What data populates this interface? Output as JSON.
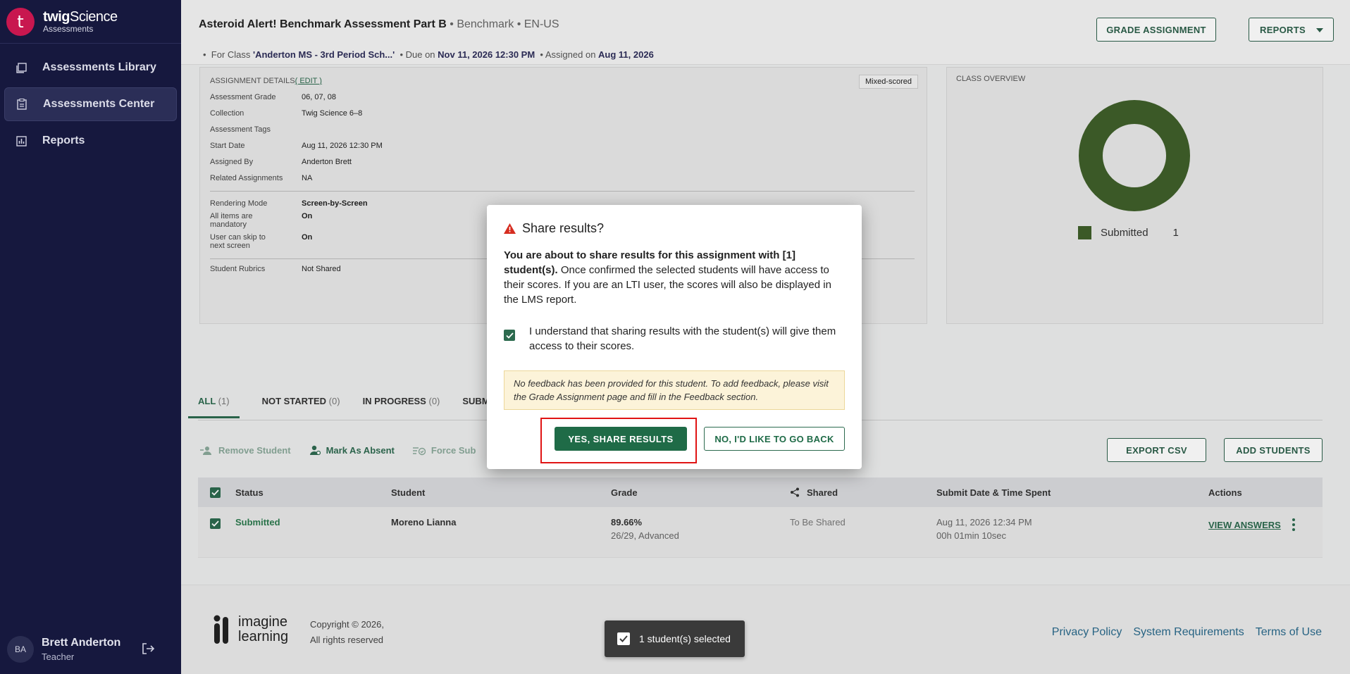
{
  "brand": {
    "name_prefix": "twig",
    "name_suffix": "Science",
    "subtitle": "Assessments",
    "logo_letter": "t"
  },
  "sidebar": {
    "items": [
      {
        "label": "Assessments Library",
        "icon": "library-icon"
      },
      {
        "label": "Assessments Center",
        "icon": "clipboard-icon",
        "active": true
      },
      {
        "label": "Reports",
        "icon": "bar-chart-icon"
      }
    ]
  },
  "user": {
    "initials": "BA",
    "name": "Brett Anderton",
    "role": "Teacher"
  },
  "header": {
    "title": "Asteroid Alert! Benchmark Assessment Part B",
    "type": "• Benchmark",
    "locale": "• EN-US",
    "class_prefix": "For Class ",
    "class_name": "'Anderton MS - 3rd Period Sch...'",
    "due_prefix": "•  Due on ",
    "due_date": "Nov 11, 2026 12:30 PM",
    "assigned_prefix": "•  Assigned on ",
    "assigned_date": "Aug 11, 2026",
    "grade_button": "GRADE ASSIGNMENT",
    "reports_button": "REPORTS"
  },
  "details": {
    "label": "ASSIGNMENT DETAILS",
    "edit_link": "( EDIT )",
    "scoring_badge": "Mixed-scored",
    "rows": [
      {
        "k": "Assessment Grade",
        "v": "06, 07, 08"
      },
      {
        "k": "Collection",
        "v": "Twig Science 6–8"
      },
      {
        "k": "Assessment Tags",
        "v": ""
      },
      {
        "k": "Start Date",
        "v": "Aug 11, 2026 12:30 PM"
      },
      {
        "k": "Assigned By",
        "v": "Anderton Brett"
      },
      {
        "k": "Related Assignments",
        "v": "NA"
      }
    ],
    "rows2": [
      {
        "k": "Rendering Mode",
        "v": "Screen-by-Screen"
      },
      {
        "k": "All items are mandatory",
        "v": "On"
      },
      {
        "k": "User can skip to next screen",
        "v": "On"
      }
    ],
    "rows3": [
      {
        "k": "Student Rubrics",
        "v": "Not Shared"
      }
    ]
  },
  "overview": {
    "label": "CLASS OVERVIEW",
    "legend": "Submitted",
    "count": "1",
    "color": "#3f5f2a"
  },
  "tabs": [
    {
      "label": "ALL",
      "count": "(1)"
    },
    {
      "label": "NOT STARTED",
      "count": "(0)"
    },
    {
      "label": "IN PROGRESS",
      "count": "(0)"
    },
    {
      "label": "SUBM",
      "count": ""
    }
  ],
  "actions": {
    "remove": "Remove Student",
    "absent": "Mark As Absent",
    "force": "Force Sub",
    "export": "EXPORT CSV",
    "add": "ADD STUDENTS"
  },
  "table": {
    "headers": {
      "status": "Status",
      "student": "Student",
      "grade": "Grade",
      "shared": "Shared",
      "submit": "Submit Date & Time Spent",
      "actions": "Actions"
    },
    "rows": [
      {
        "status": "Submitted",
        "student": "Moreno Lianna",
        "grade": "89.66%",
        "grade_detail": "26/29, Advanced",
        "shared": "To Be Shared",
        "submit_date": "Aug 11, 2026 12:34 PM",
        "time_spent": "00h 01min 10sec",
        "action": "VIEW ANSWERS"
      }
    ]
  },
  "footer": {
    "logo_line1": "imagine",
    "logo_line2": "learning",
    "copyright1": "Copyright © 2026,",
    "copyright2": "All rights reserved",
    "links": [
      "Privacy Policy",
      "System Requirements",
      "Terms of Use"
    ]
  },
  "selection_bar": {
    "text": "1 student(s) selected"
  },
  "modal": {
    "title": "Share results?",
    "body_bold": "You are about to share results for this assignment with [1] student(s).",
    "body_rest": " Once confirmed the selected students will have access to their scores. If you are an LTI user, the scores will also be displayed in the LMS report.",
    "checkbox_label": "I understand that sharing results with the student(s) will give them access to their scores.",
    "note": "No feedback has been provided for this student. To add feedback, please visit the Grade Assignment page and fill in the Feedback section.",
    "yes_button": "YES, SHARE RESULTS",
    "no_button": "NO, I'D LIKE TO GO BACK"
  }
}
